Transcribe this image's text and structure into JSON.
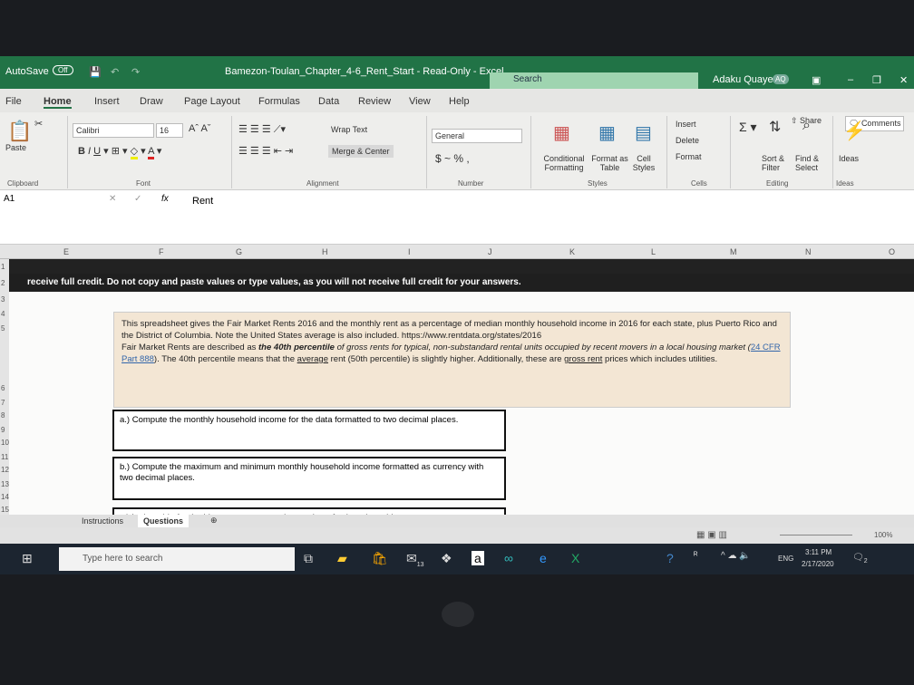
{
  "titlebar": {
    "autosave": "AutoSave",
    "autosave_state": "Off",
    "title": "Bamezon-Toulan_Chapter_4-6_Rent_Start  -  Read-Only  -  Excel",
    "search": "Search",
    "user": "Adaku Quaye",
    "initials": "AQ"
  },
  "tabs": [
    "File",
    "Home",
    "Insert",
    "Draw",
    "Page Layout",
    "Formulas",
    "Data",
    "Review",
    "View",
    "Help"
  ],
  "ribbon": {
    "share": "Share",
    "comments": "Comments",
    "paste": "Paste",
    "clipboard": "Clipboard",
    "font_name": "Calibri",
    "font_size": "16",
    "font": "Font",
    "wrap": "Wrap Text",
    "merge": "Merge & Center",
    "alignment": "Alignment",
    "number_format": "General",
    "currency": "$ ~ % ,",
    "number": "Number",
    "cond": "Conditional Formatting",
    "fmt_table": "Format as Table",
    "cell_styles": "Cell Styles",
    "styles": "Styles",
    "insert": "Insert",
    "delete": "Delete",
    "format": "Format",
    "cells": "Cells",
    "sort": "Sort & Filter",
    "find": "Find & Select",
    "editing": "Editing",
    "ideas": "Ideas",
    "ideas_grp": "Ideas"
  },
  "formula_bar": {
    "name_box": "A1",
    "fx": "fx",
    "value": "Rent"
  },
  "columns": [
    "E",
    "F",
    "G",
    "H",
    "I",
    "J",
    "K",
    "L",
    "M",
    "N",
    "O"
  ],
  "rows": [
    "1",
    "2",
    "3",
    "4",
    "5",
    "6",
    "7",
    "8",
    "9",
    "10",
    "11",
    "12",
    "13",
    "14",
    "15"
  ],
  "sheet": {
    "row2": "receive full credit. Do not copy and paste values or type values, as you will not receive full credit for your answers.",
    "intro_1": "This spreadsheet gives the Fair Market Rents 2016 and the monthly rent as a percentage of median monthly household income in 2016 for each state, plus Puerto Rico and the District of Columbia. Note the United States average is also included.  https://www.rentdata.org/states/2016",
    "intro_2a": "Fair Market Rents are described as ",
    "intro_2b": "the 40th percentile",
    "intro_2c": " of gross rents for typical, non-substandard rental units occupied by recent movers in a local housing market (",
    "intro_link": "24 CFR Part 888",
    "intro_2d": "). The 40th percentile means that the ",
    "intro_avg": "average",
    "intro_2e": " rent (50th percentile) is slightly higher. Additionally, these are ",
    "intro_gross": "gross rent",
    "intro_2f": " prices which includes utilities.",
    "qa": "a.) Compute the monthly household income for the data formatted to two decimal places.",
    "qb": "b.) Compute the maximum and minimum monthly household income formatted as currency with two decimal places.",
    "qc": "c.) In the table for the histogram, compute the number of values (monthly"
  },
  "sheet_tabs": [
    "Instructions",
    "Questions"
  ],
  "status": {
    "zoom": "100%"
  },
  "taskbar": {
    "search": "Type here to search",
    "mail_count": "13",
    "lang": "ENG",
    "time": "3:11 PM",
    "date": "2/17/2020",
    "notif": "2"
  }
}
